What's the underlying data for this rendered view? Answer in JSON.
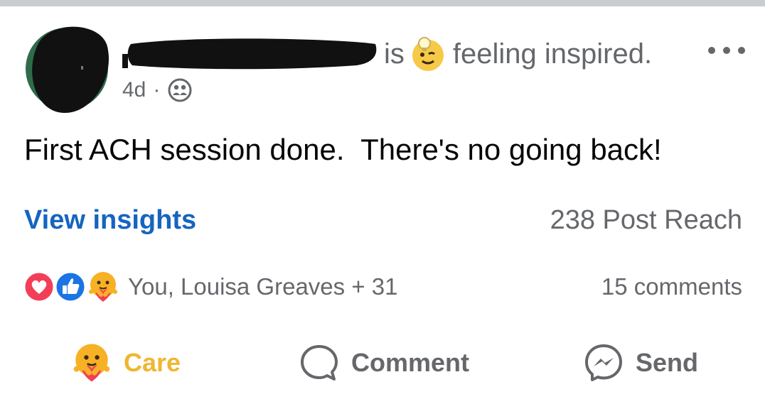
{
  "post": {
    "author_verb": "is",
    "feeling_text": "feeling inspired.",
    "timestamp": "4d",
    "meta_separator": "·",
    "audience_icon": "friends-icon",
    "text": "First ACH session done.  There's no going back!"
  },
  "insights": {
    "link_label": "View insights",
    "reach_text": "238 Post Reach"
  },
  "reactions": {
    "icons": [
      "love-icon",
      "like-icon",
      "care-icon"
    ],
    "names_text": "You, Louisa Greaves + 31",
    "comments_text": "15 comments"
  },
  "actions": {
    "care_label": "Care",
    "comment_label": "Comment",
    "send_label": "Send"
  },
  "colors": {
    "link_blue": "#1565c0",
    "care_gold": "#f0b632",
    "secondary_text": "#65676b",
    "love_red": "#f33e58",
    "like_blue": "#1b74e4"
  }
}
